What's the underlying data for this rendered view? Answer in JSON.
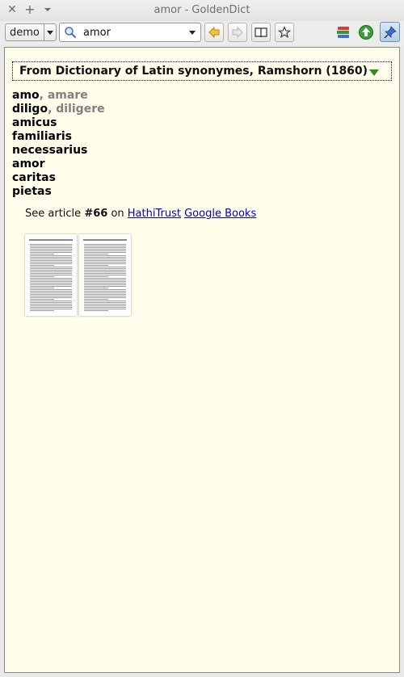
{
  "window": {
    "title": "amor - GoldenDict"
  },
  "titlebar": {
    "close_icon": "close-icon",
    "add_icon": "plus-icon",
    "menu_icon": "chevron-down-icon"
  },
  "toolbar": {
    "group": {
      "selected": "demo"
    },
    "search": {
      "value": "amor"
    },
    "buttons": [
      "back-icon",
      "forward-icon",
      "book-icon",
      "star-icon"
    ],
    "right_icons": [
      "books-icon",
      "scan-up-icon",
      "pin-icon"
    ]
  },
  "article": {
    "dict_title": "From Dictionary of Latin synonymes, Ramshorn (1860)",
    "words": [
      {
        "main": "amo",
        "extra": ", amare"
      },
      {
        "main": "diligo",
        "extra": ", diligere"
      },
      {
        "main": "amicus",
        "extra": ""
      },
      {
        "main": "familiaris",
        "extra": ""
      },
      {
        "main": "necessarius",
        "extra": ""
      },
      {
        "main": "amor",
        "extra": ""
      },
      {
        "main": "caritas",
        "extra": ""
      },
      {
        "main": "pietas",
        "extra": ""
      }
    ],
    "see": {
      "prefix": "See article",
      "number": "#66",
      "on": "on",
      "link1": "HathiTrust",
      "link2": "Google Books"
    },
    "pages": [
      "page-thumbnail-1",
      "page-thumbnail-2"
    ]
  }
}
